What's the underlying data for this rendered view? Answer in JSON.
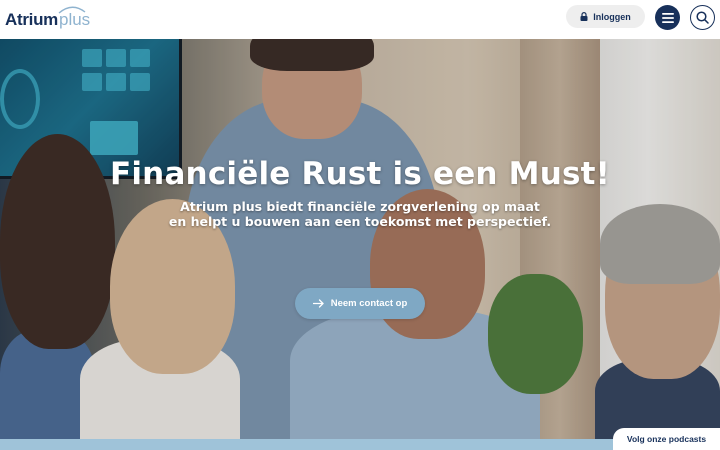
{
  "brand": {
    "logo_main": "Atrium",
    "logo_accent": "plus",
    "primary_color": "#17305a",
    "accent_color": "#7fa8c4"
  },
  "header": {
    "login_label": "Inloggen",
    "login_icon": "lock-icon",
    "menu_icon": "hamburger-menu-icon",
    "search_icon": "search-icon"
  },
  "hero": {
    "title": "Financiële Rust is een Must!",
    "subtitle_line1": "Atrium plus biedt financiële zorgverlening op maat",
    "subtitle_line2": "en helpt u bouwen aan een toekomst met perspectief.",
    "cta_label": "Neem contact op",
    "cta_icon": "arrow-right-icon"
  },
  "podcast_tab": {
    "label": "Volg onze podcasts"
  }
}
